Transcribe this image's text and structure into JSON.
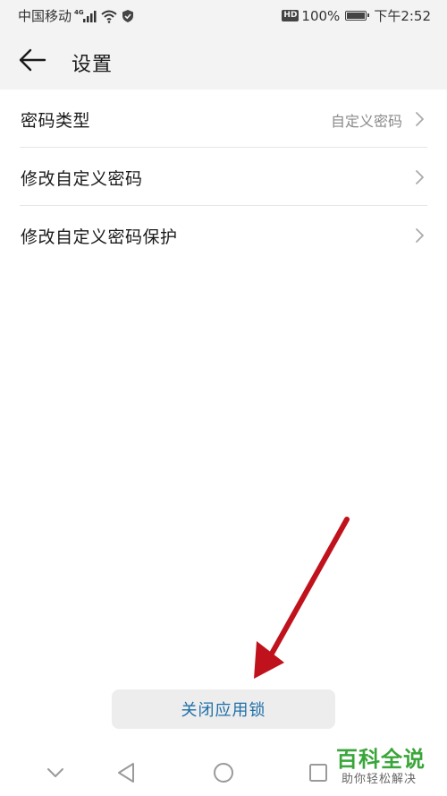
{
  "status_bar": {
    "carrier": "中国移动",
    "network": "4G",
    "hd": "HD",
    "battery": "100%",
    "time": "下午2:52"
  },
  "header": {
    "title": "设置"
  },
  "settings": {
    "items": [
      {
        "label": "密码类型",
        "value": "自定义密码"
      },
      {
        "label": "修改自定义密码",
        "value": ""
      },
      {
        "label": "修改自定义密码保护",
        "value": ""
      }
    ]
  },
  "footer": {
    "button_label": "关闭应用锁"
  },
  "annotation": {
    "arrow_color": "#c0121c"
  },
  "watermark": {
    "title": "百科全说",
    "subtitle": "助你轻松解决"
  },
  "colors": {
    "accent": "#1f6fa8",
    "header_bg": "#f3f3f3"
  }
}
